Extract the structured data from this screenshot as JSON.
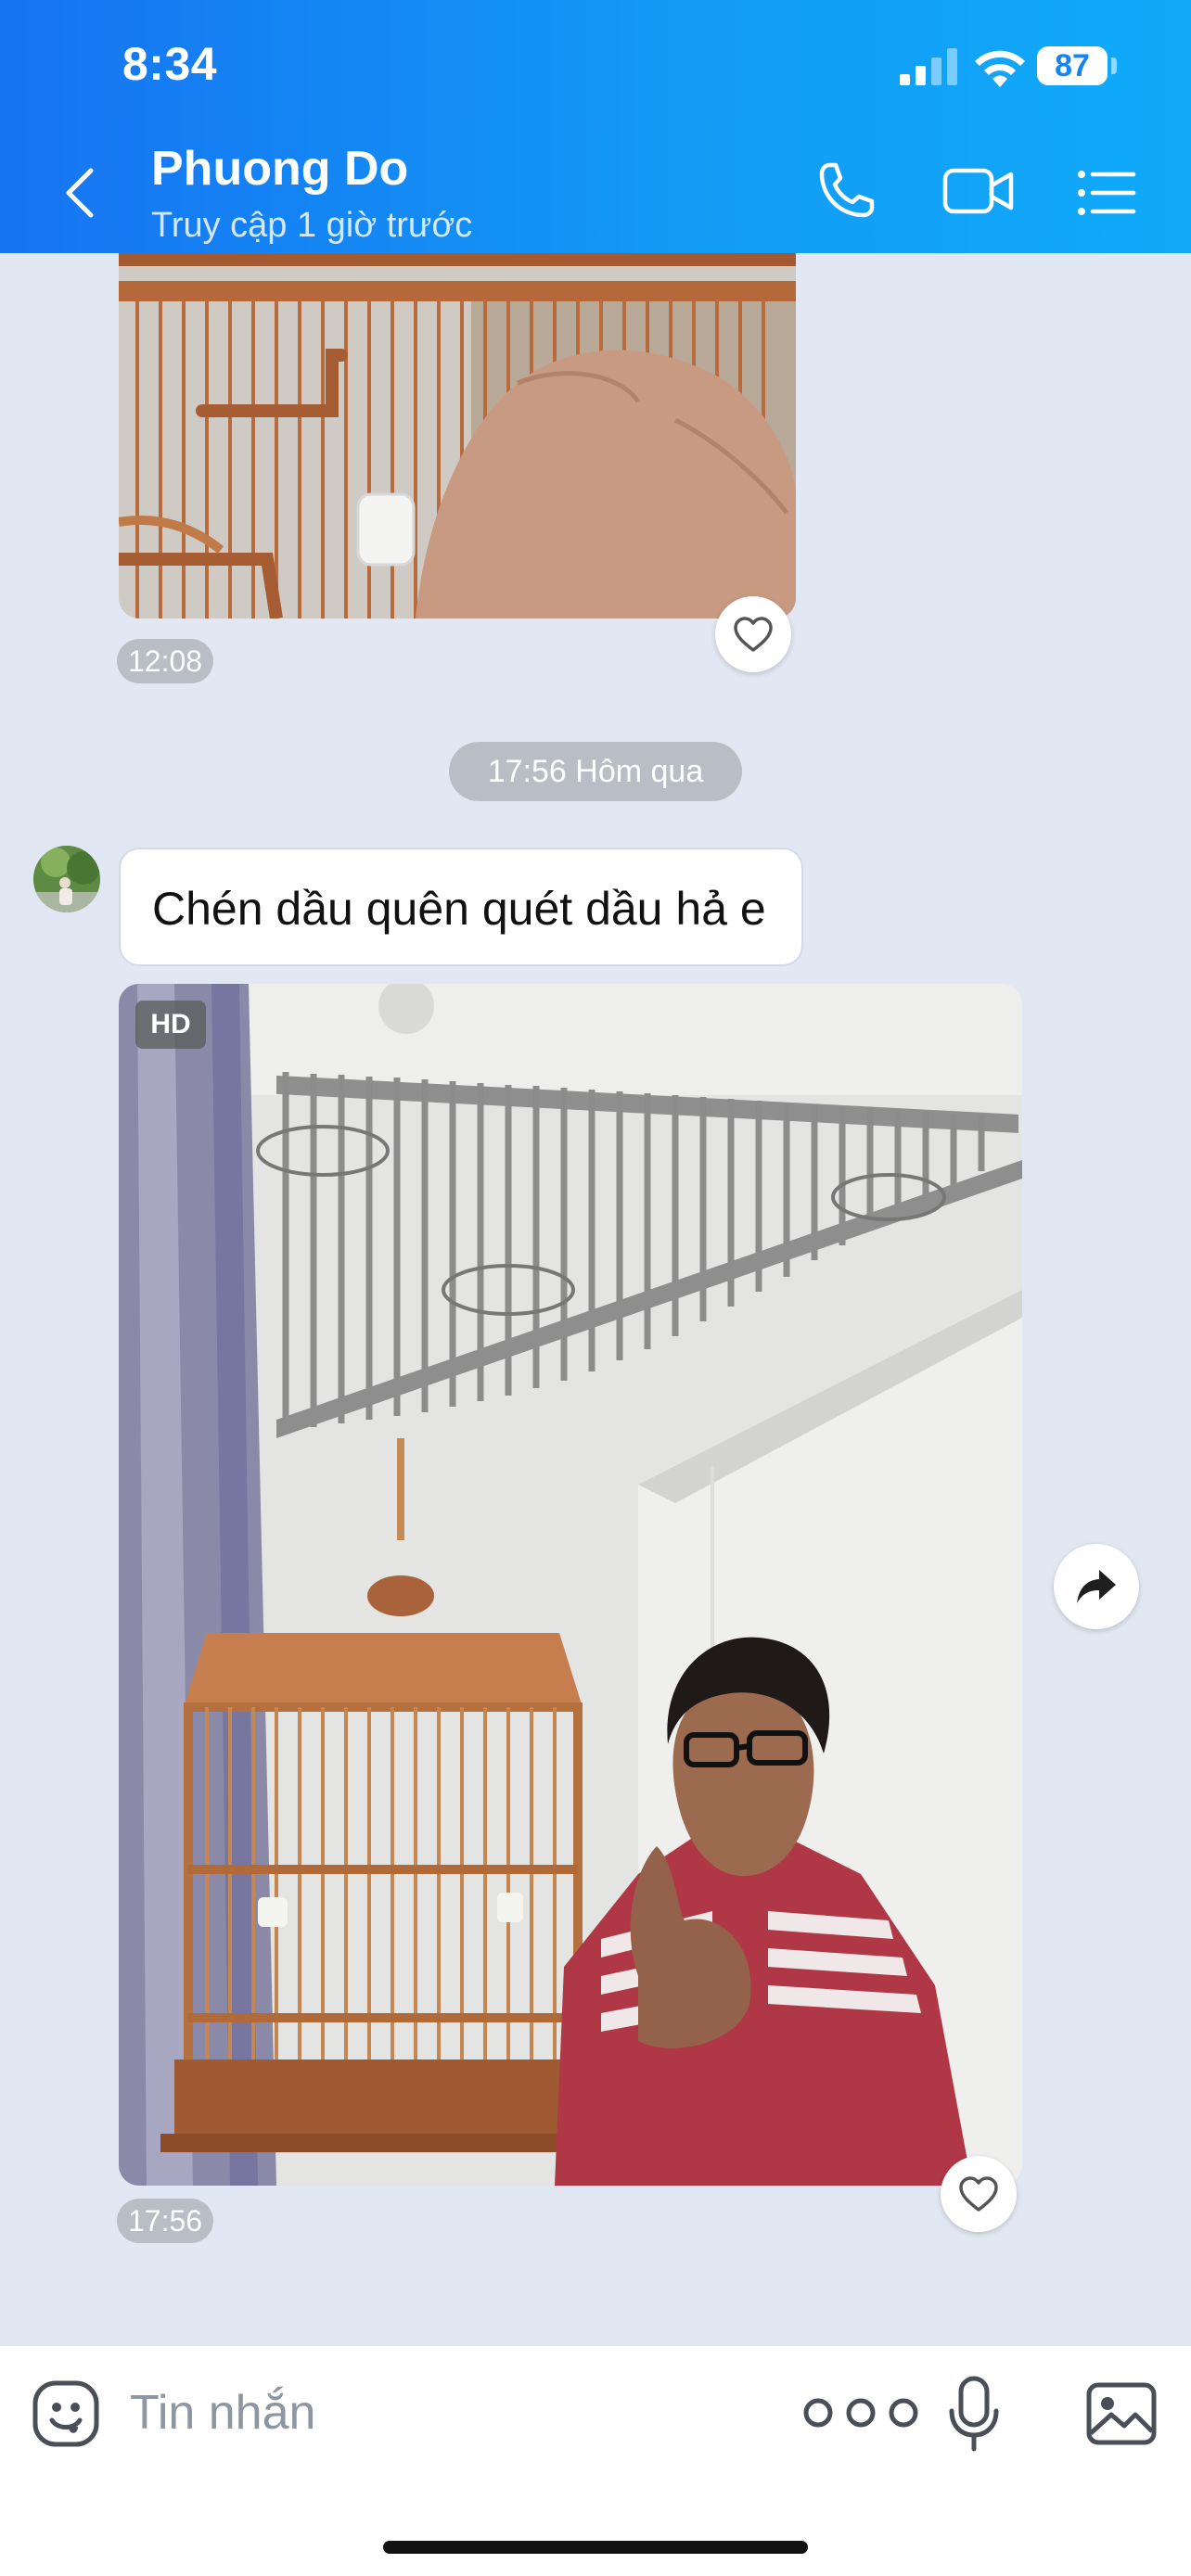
{
  "status_bar": {
    "time": "8:34",
    "battery": "87"
  },
  "header": {
    "contact_name": "Phuong Do",
    "contact_status": "Truy cập 1 giờ trước",
    "icons": [
      "back-icon",
      "phone-icon",
      "video-call-icon",
      "list-menu-icon"
    ]
  },
  "messages": {
    "photo1_time": "12:08",
    "day_separator": "17:56 Hôm qua",
    "text_message": "Chén dầu quên quét dầu hả e",
    "photo2_badge": "HD",
    "photo2_time": "17:56"
  },
  "composer": {
    "placeholder": "Tin nhắn",
    "icons": [
      "emoji-icon",
      "more-icon",
      "microphone-icon",
      "gallery-icon"
    ]
  },
  "colors": {
    "header_gradient_start": "#1673f2",
    "header_gradient_end": "#10aaf8",
    "chat_background": "#e2e8f3",
    "time_chip": "#b9bec6"
  }
}
